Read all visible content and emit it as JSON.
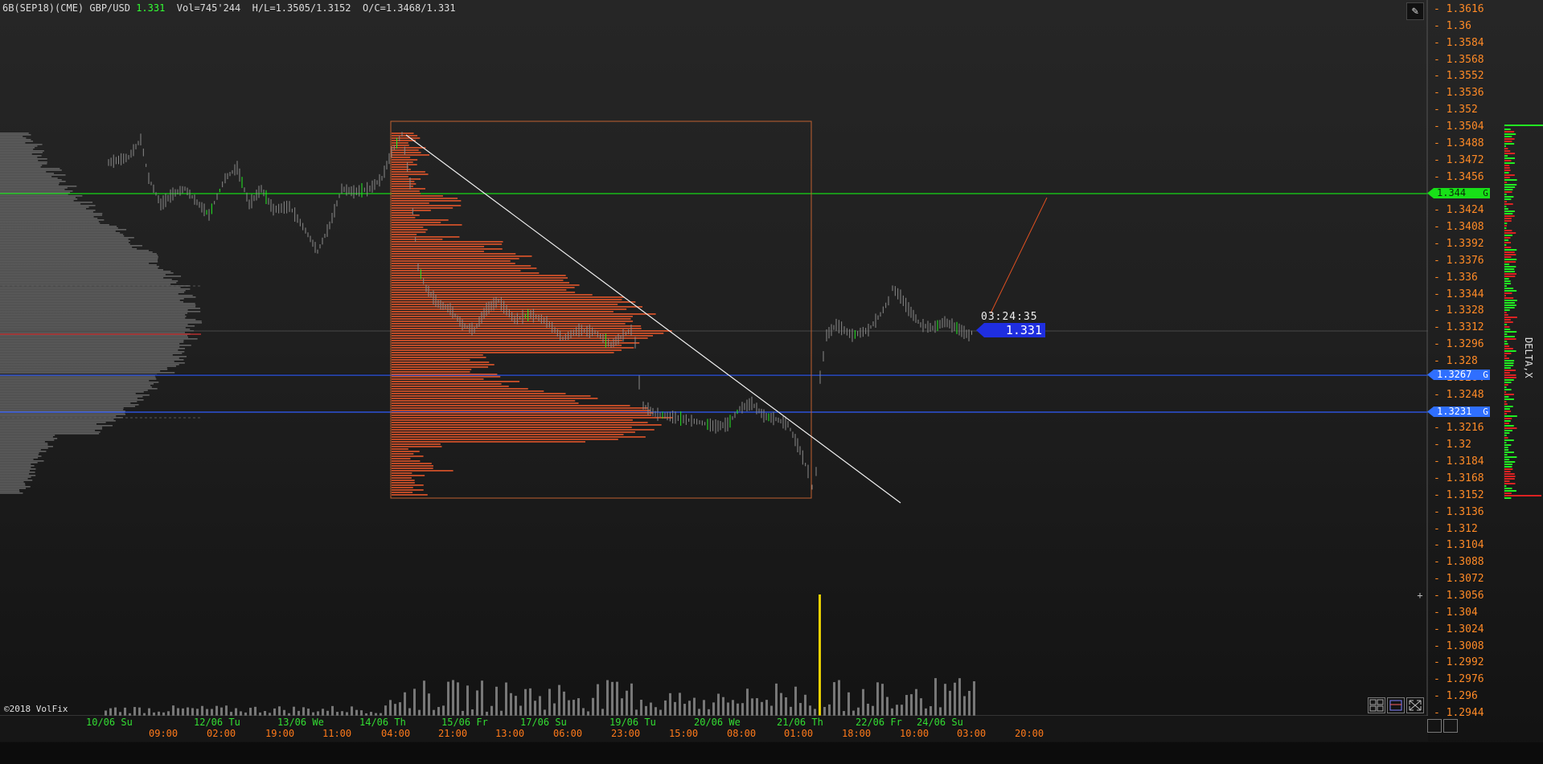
{
  "header": {
    "instrument": "6B(SEP18)(CME) GBP/USD",
    "last": "1.331",
    "stats": "Vol=745'244  H/L=1.3505/1.3152  O/C=1.3468/1.331"
  },
  "copyright": "©2018 VolFix",
  "delta_label": "DELTA,X",
  "current_price": "1.331",
  "timer": "03:24:35",
  "level_tags": [
    {
      "label": "1.344",
      "color": "#18e018",
      "text_color": "#0a2a0a"
    },
    {
      "label": "1.3267",
      "color": "#2f6fff",
      "text_color": "#ffffff"
    },
    {
      "label": "1.3231",
      "color": "#2f6fff",
      "text_color": "#ffffff"
    }
  ],
  "level_tag_suffix": "G",
  "price_axis": {
    "min": 1.2944,
    "max": 1.3616,
    "labels": [
      "1.3616",
      "1.36",
      "1.3584",
      "1.3568",
      "1.3552",
      "1.3536",
      "1.352",
      "1.3504",
      "1.3488",
      "1.3472",
      "1.3456",
      "1.344",
      "1.3424",
      "1.3408",
      "1.3392",
      "1.3376",
      "1.336",
      "1.3344",
      "1.3328",
      "1.3312",
      "1.3296",
      "1.328",
      "1.3264",
      "1.3248",
      "1.3232",
      "1.3216",
      "1.32",
      "1.3184",
      "1.3168",
      "1.3152",
      "1.3136",
      "1.312",
      "1.3104",
      "1.3088",
      "1.3072",
      "1.3056",
      "1.304",
      "1.3024",
      "1.3008",
      "1.2992",
      "1.2976",
      "1.296",
      "1.2944"
    ]
  },
  "time_axis": {
    "dates": [
      "10/06 Su",
      "12/06 Tu",
      "13/06 We",
      "14/06 Th",
      "15/06 Fr",
      "17/06 Su",
      "19/06 Tu",
      "20/06 We",
      "21/06 Th",
      "22/06 Fr",
      "24/06 Su"
    ],
    "times": [
      "09:00",
      "02:00",
      "19:00",
      "11:00",
      "04:00",
      "21:00",
      "13:00",
      "06:00",
      "23:00",
      "15:00",
      "08:00",
      "01:00",
      "18:00",
      "10:00",
      "03:00",
      "20:00"
    ]
  },
  "colors": {
    "profile": "#e0552a",
    "candle": "#8a8a8a",
    "up": "#22ee22",
    "level_green": "#16d916",
    "level_blue": "#2f5cff",
    "axis_text": "#ff8a26"
  },
  "icons": [
    "pencil-icon",
    "grid-icon",
    "layout-icon",
    "expand-icon",
    "crosshair-icon"
  ]
}
